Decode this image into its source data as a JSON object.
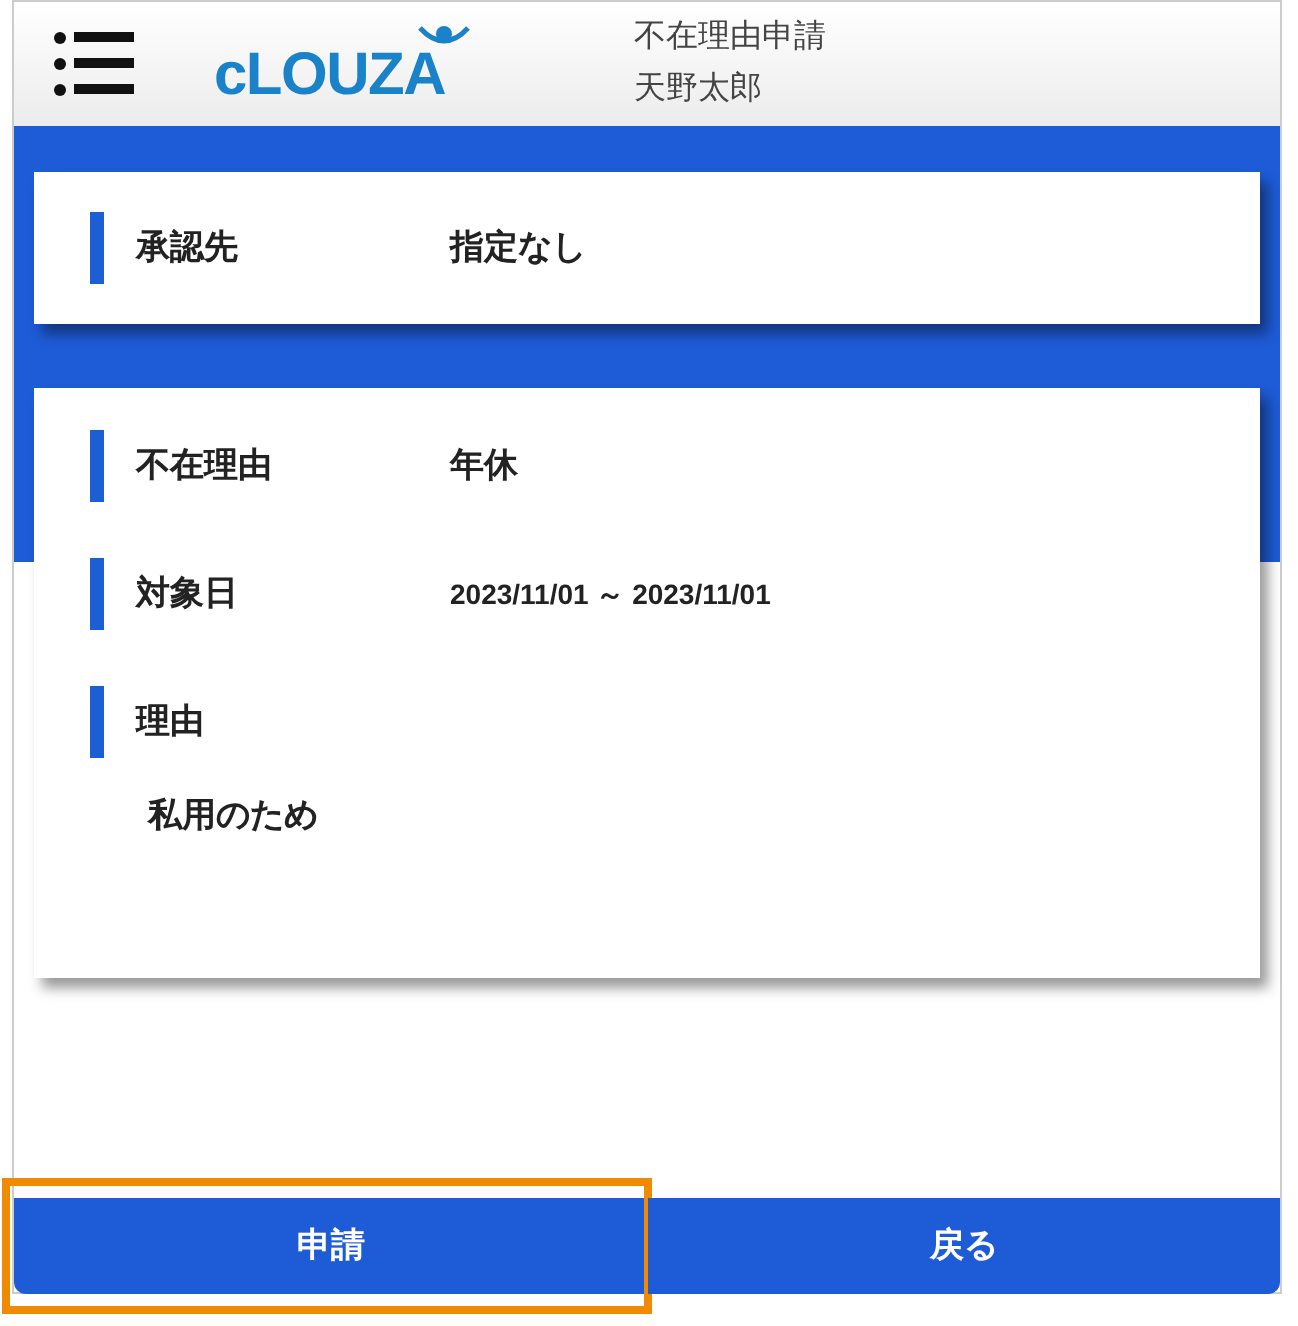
{
  "header": {
    "logo": "cLOUZA",
    "title": "不在理由申請",
    "user": "天野太郎"
  },
  "approver": {
    "label": "承認先",
    "value": "指定なし"
  },
  "details": [
    {
      "kind": "pair",
      "label": "不在理由",
      "value": "年休"
    },
    {
      "kind": "date",
      "label": "対象日",
      "value": "2023/11/01 ～ 2023/11/01"
    },
    {
      "kind": "block",
      "label": "理由",
      "value": "私用のため"
    }
  ],
  "buttons": [
    {
      "label": "申請",
      "highlighted": true
    },
    {
      "label": "戻る",
      "highlighted": false
    }
  ]
}
